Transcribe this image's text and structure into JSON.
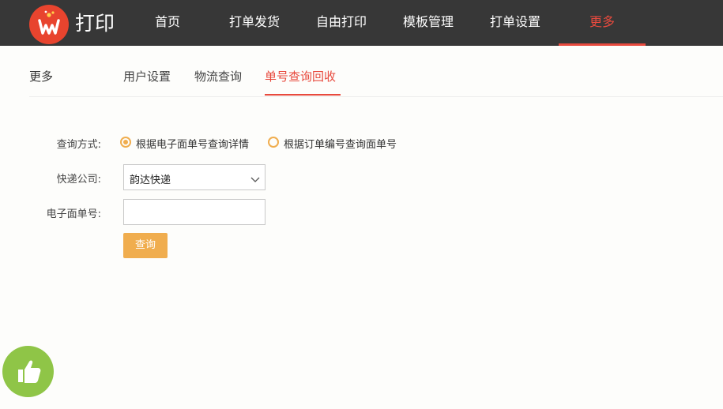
{
  "app": {
    "logo_text": "打印"
  },
  "nav": {
    "items": [
      {
        "label": "首页"
      },
      {
        "label": "打单发货"
      },
      {
        "label": "自由打印"
      },
      {
        "label": "模板管理"
      },
      {
        "label": "打单设置"
      },
      {
        "label": "更多",
        "active": true
      }
    ]
  },
  "subnav": {
    "section_title": "更多",
    "tabs": [
      {
        "label": "用户设置"
      },
      {
        "label": "物流查询"
      },
      {
        "label": "单号查询回收",
        "active": true
      }
    ]
  },
  "form": {
    "query_method": {
      "label": "查询方式:",
      "options": [
        {
          "label": "根据电子面单号查询详情",
          "checked": true
        },
        {
          "label": "根据订单编号查询面单号",
          "checked": false
        }
      ]
    },
    "courier": {
      "label": "快递公司:",
      "value": "韵达快递"
    },
    "waybill": {
      "label": "电子面单号:",
      "value": "",
      "placeholder": ""
    },
    "submit_label": "查询"
  },
  "colors": {
    "accent": "#e84a3e",
    "button": "#f0ad4e",
    "topbar": "#373737",
    "like": "#8fc547"
  },
  "icons": {
    "logo": "logo-icon",
    "select": "chevron-down-icon",
    "floating": "thumbs-up-icon"
  }
}
